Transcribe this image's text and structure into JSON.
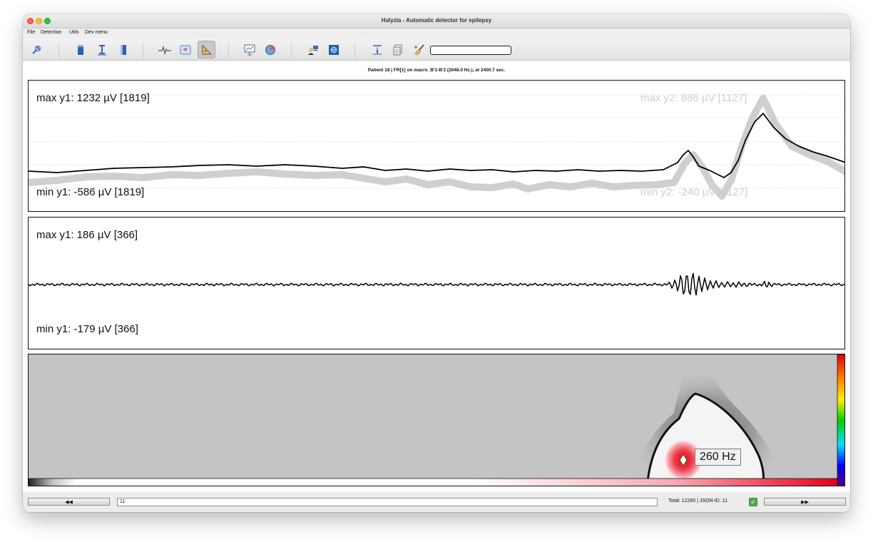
{
  "window": {
    "title": "Halyzia - Automatic detector for epilepsy"
  },
  "menu": [
    "File",
    "Detection",
    "Utils",
    "Dev menu"
  ],
  "toolbar": {
    "icons": [
      "pin-icon",
      "tube-blue-icon",
      "cursor-i-icon",
      "tube-split-icon",
      "ecg-icon",
      "brain-heart-icon",
      "ruler-triangle-icon",
      "presentation-chart-icon",
      "pie-globe-icon",
      "agent-computer-icon",
      "brain-scan-icon",
      "info-funnel-icon",
      "document-stack-icon",
      "broom-icon"
    ],
    "active_icon": "ruler-triangle-icon",
    "search_value": ""
  },
  "info_line": "Patient 18   |   FR[1] on macro_B'1-B'2 (2048.0 Hz.), at 2400.7 sec.",
  "panel1": {
    "max_y1": "max y1: 1232 µV [1819]",
    "min_y1": "min y1: -586 µV [1819]",
    "max_y2": "max y2: 886 µV [1127]",
    "min_y2": "min y2: -240 µV [1127]"
  },
  "panel2": {
    "max_y1": "max y1: 186 µV [366]",
    "min_y1": "min y1: -179 µV [366]"
  },
  "panel3": {
    "peak_frequency": "260 Hz",
    "colormap": [
      "#e00000",
      "#ff8000",
      "#ffee00",
      "#00d000",
      "#00e0ff",
      "#0000ff",
      "#550077"
    ]
  },
  "bottom": {
    "prev_label": "◀◀",
    "next_label": "▶▶",
    "id_value": "11",
    "status": "Total: 12260   |   JSON-ID: 11",
    "checked": true
  },
  "colors": {
    "signal": "#000000",
    "overlay_signal": "#cfcfcf",
    "hot": "#e8001e"
  }
}
